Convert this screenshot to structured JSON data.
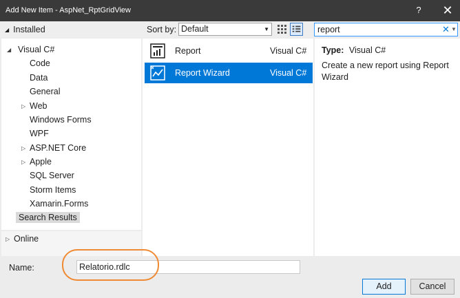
{
  "window": {
    "title": "Add New Item - AspNet_RptGridView",
    "help": "?",
    "close": "✕"
  },
  "toolbar": {
    "installed": "Installed",
    "sort_label": "Sort by:",
    "sort_value": "Default",
    "search_value": "report"
  },
  "tree": {
    "root": "Visual C#",
    "children": [
      "Code",
      "Data",
      "General",
      "Web",
      "Windows Forms",
      "WPF",
      "ASP.NET Core",
      "Apple",
      "SQL Server",
      "Storm Items",
      "Xamarin.Forms"
    ],
    "selected": "Search Results",
    "online": "Online"
  },
  "items": [
    {
      "name": "Report",
      "lang": "Visual C#"
    },
    {
      "name": "Report Wizard",
      "lang": "Visual C#"
    }
  ],
  "details": {
    "type_label": "Type:",
    "type_value": "Visual C#",
    "description": "Create a new report using Report Wizard"
  },
  "footer": {
    "name_label": "Name:",
    "name_value": "Relatorio.rdlc",
    "add": "Add",
    "cancel": "Cancel"
  },
  "colors": {
    "accent": "#0078d7",
    "highlight": "#ef8a33",
    "titlebar": "#3a3a3a"
  }
}
